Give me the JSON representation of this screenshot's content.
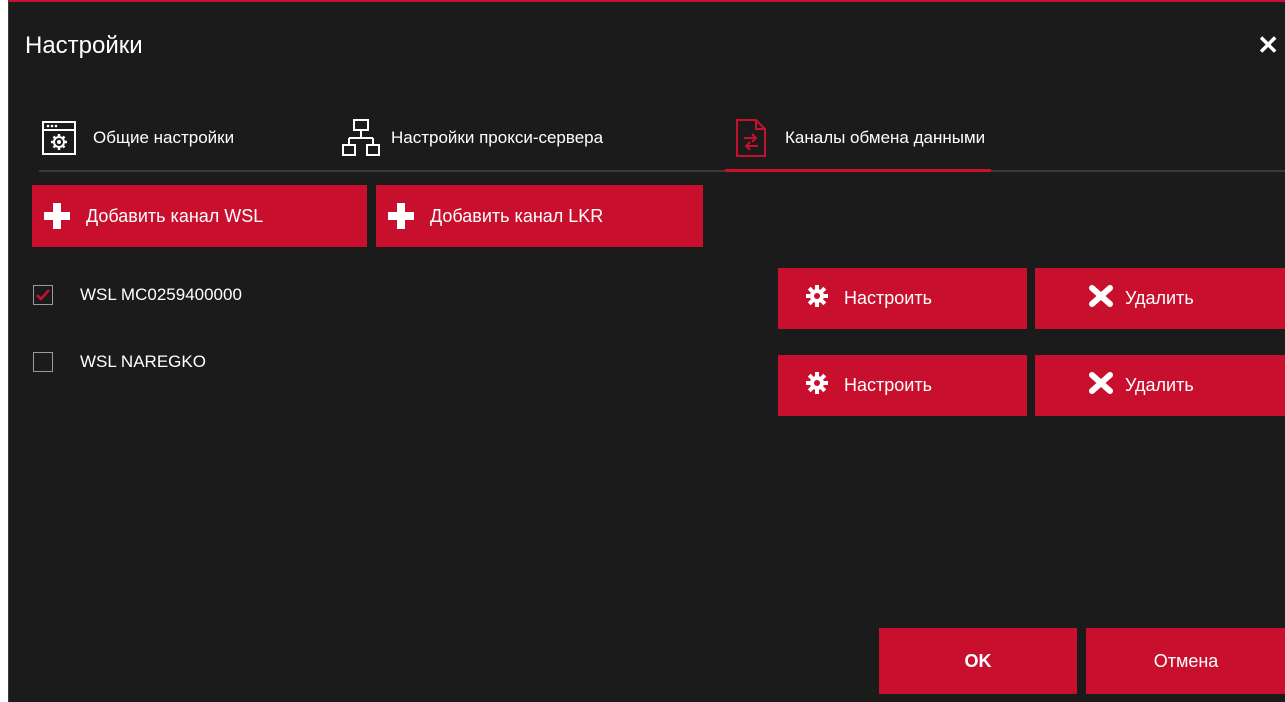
{
  "window": {
    "title": "Настройки",
    "close_glyph": "✕"
  },
  "tabs": [
    {
      "label": "Общие настройки",
      "icon": "settings-window-icon"
    },
    {
      "label": "Настройки прокси-сервера",
      "icon": "network-icon"
    },
    {
      "label": "Каналы обмена данными",
      "icon": "exchange-file-icon",
      "active": true
    }
  ],
  "toolbar": {
    "add_wsl_label": "Добавить канал WSL",
    "add_lkr_label": "Добавить канал LKR"
  },
  "channels": [
    {
      "name": "WSL MC0259400000",
      "checked": true,
      "configure_label": "Настроить",
      "delete_label": "Удалить"
    },
    {
      "name": "WSL NAREGKO",
      "checked": false,
      "configure_label": "Настроить",
      "delete_label": "Удалить"
    }
  ],
  "footer": {
    "ok_label": "OK",
    "cancel_label": "Отмена"
  },
  "colors": {
    "accent": "#c8102e",
    "background": "#1b1b1b",
    "text": "#ffffff"
  }
}
